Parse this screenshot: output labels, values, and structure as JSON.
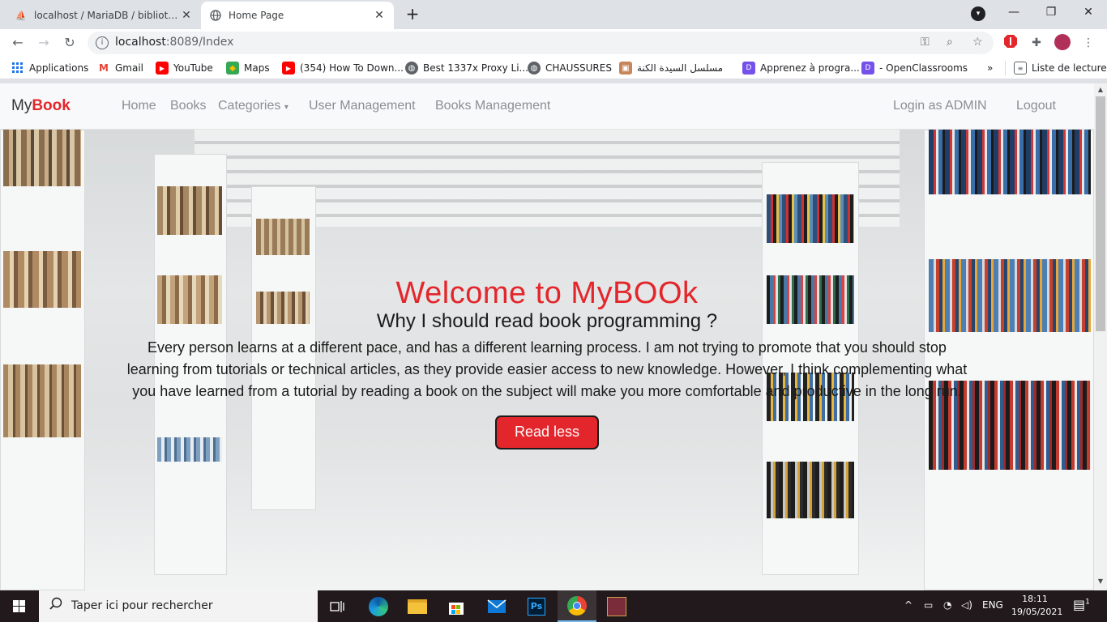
{
  "browser": {
    "tabs": [
      {
        "title": "localhost / MariaDB / bibliotheque",
        "active": false
      },
      {
        "title": "Home Page",
        "active": true
      }
    ],
    "url_host": "localhost",
    "url_rest": ":8089/Index",
    "bookmarks": [
      {
        "label": "Applications",
        "icon": "apps-grid-icon"
      },
      {
        "label": "Gmail",
        "icon": "gmail-icon"
      },
      {
        "label": "YouTube",
        "icon": "youtube-icon"
      },
      {
        "label": "Maps",
        "icon": "maps-icon"
      },
      {
        "label": "(354) How To Down...",
        "icon": "youtube-icon"
      },
      {
        "label": "Best 1337x Proxy Li...",
        "icon": "globe-icon"
      },
      {
        "label": "CHAUSSURES",
        "icon": "globe-icon"
      },
      {
        "label": "مسلسل السيدة الكنة",
        "icon": "site-icon"
      },
      {
        "label": "Apprenez à progra...",
        "icon": "openclassrooms-icon"
      },
      {
        "label": "- OpenClassrooms",
        "icon": "openclassrooms-icon"
      }
    ],
    "overflow": "»",
    "reading_list": "Liste de lecture"
  },
  "site": {
    "brand_prefix": "My",
    "brand_accent": "Book",
    "nav": {
      "home": "Home",
      "books": "Books",
      "categories": "Categories",
      "user_management": "User Management",
      "books_management": "Books Management",
      "login": "Login as ADMIN",
      "logout": "Logout"
    },
    "hero": {
      "title": "Welcome to MyBOOk",
      "subtitle": "Why I should read book programming ?",
      "paragraph": "Every person learns at a different pace, and has a different learning process. I am not trying to promote that you should stop learning from tutorials or technical articles, as they provide easier access to new knowledge. However, I think complementing what you have learned from a tutorial by reading a book on the subject will make you more comfortable and productive in the long run.",
      "button": "Read less"
    },
    "colors": {
      "accent": "#e3262b",
      "nav_text": "#8a8f94"
    }
  },
  "taskbar": {
    "search_placeholder": "Taper ici pour rechercher",
    "language": "ENG",
    "time": "18:11",
    "date": "19/05/2021",
    "notification_count": "1"
  }
}
